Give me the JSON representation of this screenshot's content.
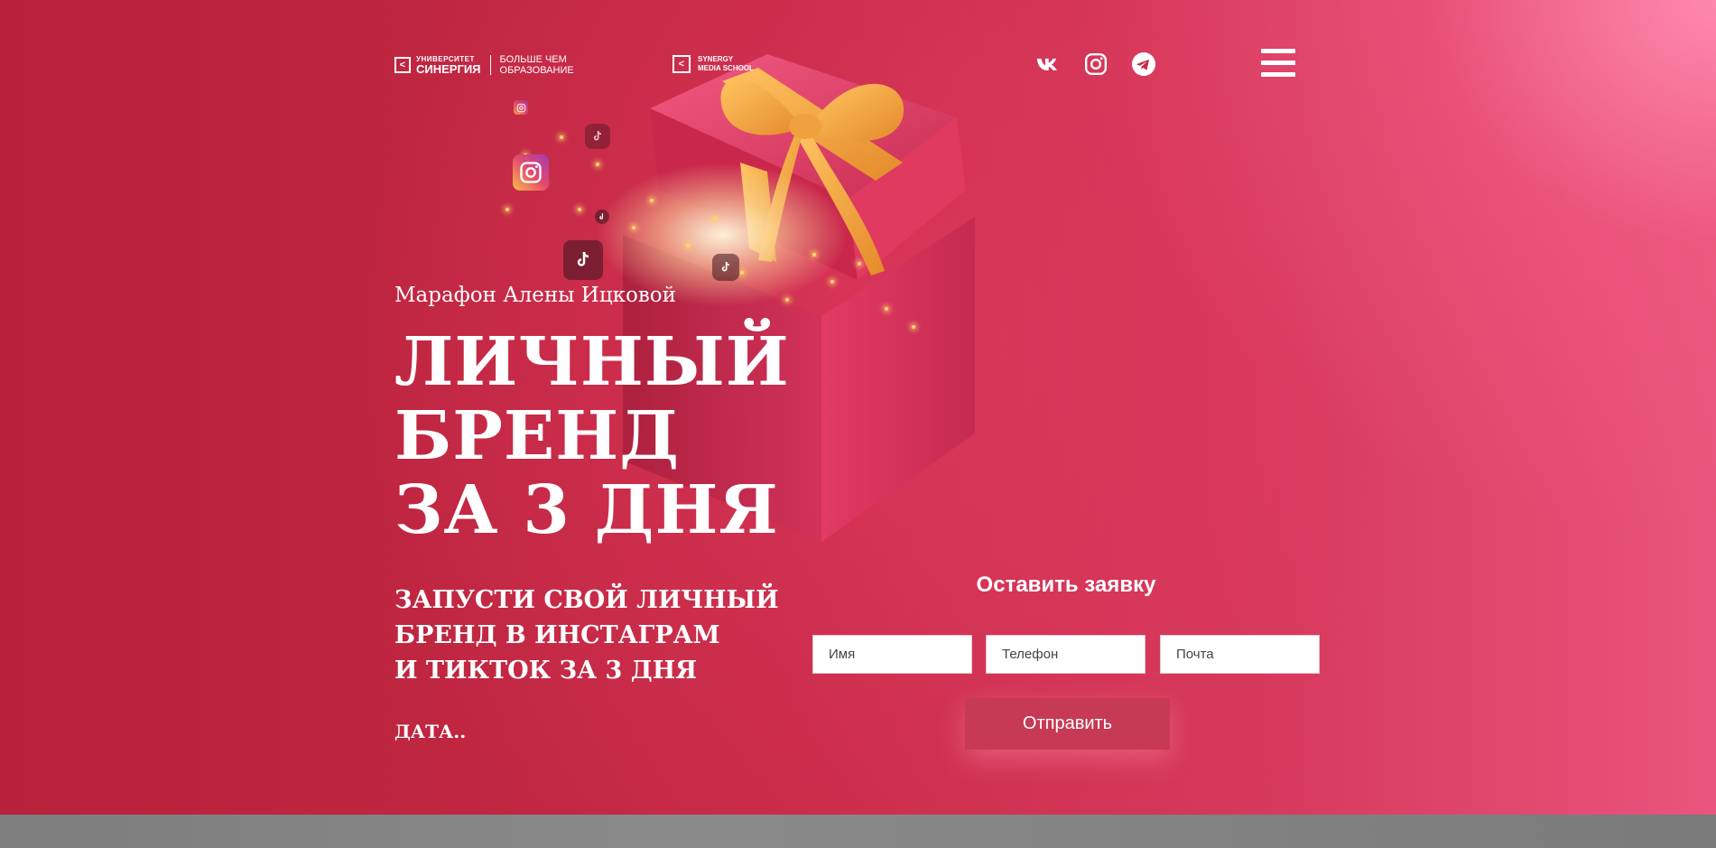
{
  "header": {
    "logo_university": {
      "top": "УНИВЕРСИТЕТ",
      "main": "СИНЕРГИЯ",
      "slogan_line1": "БОЛЬШЕ ЧЕМ",
      "slogan_line2": "ОБРАЗОВАНИЕ"
    },
    "logo_media": {
      "line1": "SYNERGY",
      "line2": "MEDIA SCHOOL"
    },
    "socials": [
      {
        "icon": "vk-icon"
      },
      {
        "icon": "instagram-icon"
      },
      {
        "icon": "telegram-icon"
      }
    ],
    "menu_icon": "hamburger-icon"
  },
  "hero": {
    "subtitle": "Марафон Алены Ицковой",
    "title_lines": [
      "ЛИЧНЫЙ",
      "БРЕНД",
      "ЗА 3 ДНЯ"
    ],
    "lead_lines": [
      "ЗАПУСТИ СВОЙ ЛИЧНЫЙ",
      "БРЕНД В ИНСТАГРАМ",
      "И ТИКТОК ЗА 3 ДНЯ"
    ],
    "date": "ДАТА.."
  },
  "form": {
    "title": "Оставить заявку",
    "name_placeholder": "Имя",
    "phone_placeholder": "Телефон",
    "email_placeholder": "Почта",
    "submit_label": "Отправить"
  },
  "colors": {
    "background": "#bd2a40",
    "accent_pink": "#e9557c",
    "button": "#c63a55",
    "bow": "#f6a640"
  }
}
